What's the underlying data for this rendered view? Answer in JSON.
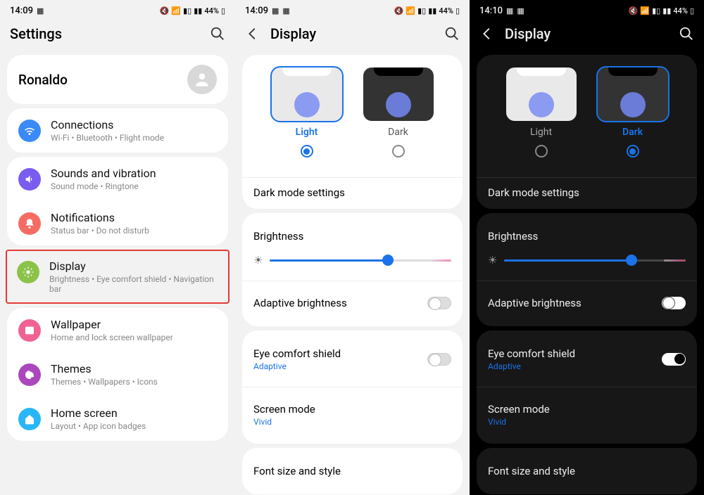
{
  "s1": {
    "status": {
      "time": "14:09",
      "battery": "44%"
    },
    "title": "Settings",
    "profile": {
      "name": "Ronaldo"
    },
    "items": [
      {
        "label": "Connections",
        "sub": "Wi-Fi  •  Bluetooth  •  Flight mode",
        "color": "#3a8af7"
      },
      {
        "label": "Sounds and vibration",
        "sub": "Sound mode  •  Ringtone",
        "color": "#7a5cf0"
      },
      {
        "label": "Notifications",
        "sub": "Status bar  •  Do not disturb",
        "color": "#f56c62"
      },
      {
        "label": "Display",
        "sub": "Brightness  •  Eye comfort shield  •  Navigation bar",
        "color": "#8bc34a"
      },
      {
        "label": "Wallpaper",
        "sub": "Home and lock screen wallpaper",
        "color": "#f06292"
      },
      {
        "label": "Themes",
        "sub": "Themes  •  Wallpapers  •  Icons",
        "color": "#ab47bc"
      },
      {
        "label": "Home screen",
        "sub": "Layout  •  App icon badges",
        "color": "#29b6f6"
      }
    ]
  },
  "s2": {
    "status": {
      "time": "14:09",
      "battery": "44%"
    },
    "title": "Display",
    "theme": {
      "light": "Light",
      "dark": "Dark",
      "selected": "light"
    },
    "dark_mode_settings": "Dark mode settings",
    "brightness": {
      "label": "Brightness",
      "pct": 65
    },
    "adaptive": {
      "label": "Adaptive brightness",
      "on": false
    },
    "eye": {
      "label": "Eye comfort shield",
      "sub": "Adaptive",
      "on": false
    },
    "screen_mode": {
      "label": "Screen mode",
      "sub": "Vivid"
    },
    "font": {
      "label": "Font size and style"
    }
  },
  "s3": {
    "status": {
      "time": "14:10",
      "battery": "44%"
    },
    "title": "Display",
    "theme": {
      "light": "Light",
      "dark": "Dark",
      "selected": "dark"
    },
    "dark_mode_settings": "Dark mode settings",
    "brightness": {
      "label": "Brightness",
      "pct": 70
    },
    "adaptive": {
      "label": "Adaptive brightness",
      "on": false
    },
    "eye": {
      "label": "Eye comfort shield",
      "sub": "Adaptive",
      "on": true
    },
    "screen_mode": {
      "label": "Screen mode",
      "sub": "Vivid"
    },
    "font": {
      "label": "Font size and style"
    }
  }
}
